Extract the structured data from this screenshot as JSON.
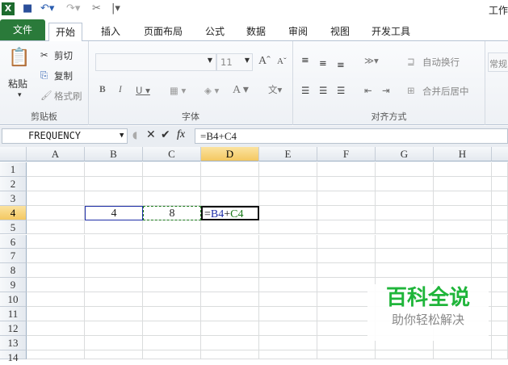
{
  "app": {
    "title": "工作"
  },
  "tabs": [
    "文件",
    "开始",
    "插入",
    "页面布局",
    "公式",
    "数据",
    "审阅",
    "视图",
    "开发工具"
  ],
  "ribbon": {
    "clipboard": {
      "label": "剪贴板",
      "paste": "粘贴",
      "cut": "剪切",
      "copy": "复制",
      "format_painter": "格式刷"
    },
    "font": {
      "label": "字体",
      "font_size": "11",
      "font_name": ""
    },
    "alignment": {
      "label": "对齐方式",
      "wrap": "自动换行",
      "merge": "合并后居中"
    },
    "number": {
      "format": "常规"
    }
  },
  "formula_bar": {
    "name_box": "FREQUENCY",
    "formula": "=B4+C4"
  },
  "columns": [
    "A",
    "B",
    "C",
    "D",
    "E",
    "F",
    "G",
    "H"
  ],
  "rows": [
    "1",
    "2",
    "3",
    "4",
    "5",
    "6",
    "7",
    "8",
    "9",
    "10",
    "11",
    "12",
    "13",
    "14"
  ],
  "cells": {
    "B4": "4",
    "C4": "8",
    "D4_parts": [
      "=",
      "B4",
      "+",
      "C4"
    ]
  },
  "colors": {
    "file_tab": "#2a7a3a",
    "ref_b4": "#1f2fa8",
    "ref_c4": "#1a7a1a",
    "selected_header": "#f4c861"
  },
  "watermark": {
    "title": "百科全说",
    "subtitle": "助你轻松解决"
  }
}
